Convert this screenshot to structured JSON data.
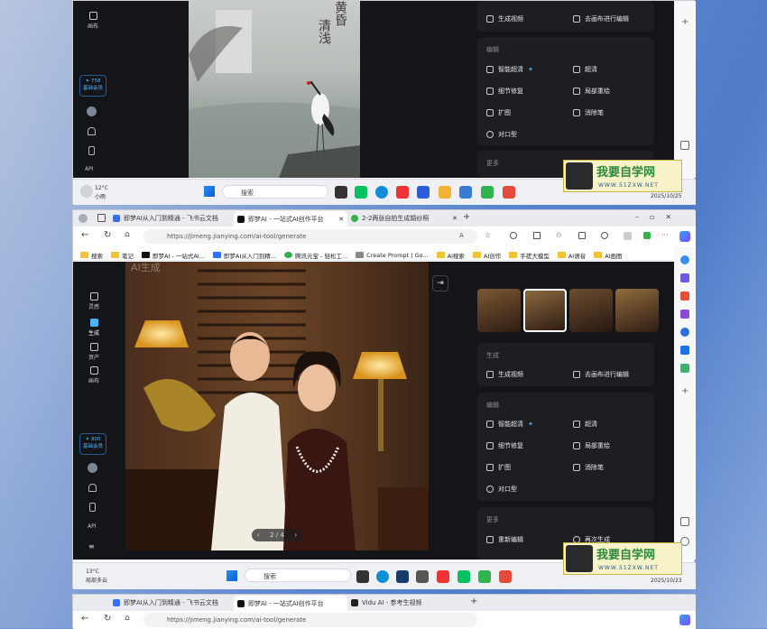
{
  "top_window": {
    "rail": {
      "layout_label": "画布",
      "credits": "✦ 758",
      "member": "基础会员",
      "api": "API"
    },
    "poster_text": [
      "黄昏",
      "清浅"
    ],
    "gen_panel": {
      "make_video": "生成视频",
      "to_canvas": "去画布进行编辑"
    },
    "edit_panel": {
      "title": "编辑",
      "smart_hd": "智能超清",
      "hd": "超清",
      "detail_fix": "细节修复",
      "local_redraw": "局部重绘",
      "expand": "扩图",
      "eraser": "消除笔",
      "lip_sync": "对口型"
    },
    "more_title": "更多"
  },
  "taskbar1": {
    "weather_temp": "12°C",
    "weather_desc": "小雨",
    "search": "搜索",
    "time": "",
    "date": "2025/10/25"
  },
  "browser": {
    "tabs": [
      {
        "label": "即梦AI从入门到精通 - 飞书云文档",
        "active": false
      },
      {
        "label": "即梦AI - 一站式AI创作平台",
        "active": true
      },
      {
        "label": "2-2两张自拍生成婚纱照",
        "active": false
      }
    ],
    "url": "https://jimeng.jianying.com/ai-tool/generate",
    "bookmarks": [
      "搜索",
      "笔记",
      "即梦AI - 一站式AI...",
      "即梦AI从入门到精...",
      "腾讯元宝 - 轻松工...",
      "Create Prompt | Go...",
      "AI搜索",
      "AI创作",
      "手搓大模型",
      "AI语音",
      "AI画图"
    ]
  },
  "app": {
    "rail": [
      {
        "label": "灵感",
        "icon": "home-icon"
      },
      {
        "label": "生成",
        "icon": "generate-icon"
      },
      {
        "label": "资产",
        "icon": "folder-icon"
      },
      {
        "label": "画布",
        "icon": "canvas-icon"
      }
    ],
    "credits": "✦ 900",
    "member": "基础会员",
    "api": "API",
    "pager": "2 / 4",
    "faded_label": "AI生成",
    "gen_panel": {
      "title": "生成",
      "make_video": "生成视频",
      "to_canvas": "去画布进行编辑"
    },
    "edit_panel": {
      "title": "编辑",
      "smart_hd": "智能超清",
      "hd": "超清",
      "detail_fix": "细节修复",
      "local_redraw": "局部重绘",
      "expand": "扩图",
      "eraser": "消除笔",
      "lip_sync": "对口型"
    },
    "more_panel": {
      "title": "更多",
      "re_edit": "重新编辑",
      "regenerate": "再次生成"
    }
  },
  "taskbar2": {
    "weather_temp": "13°C",
    "weather_desc": "局部多云",
    "search": "搜索",
    "date": "2025/10/23"
  },
  "bottom_browser": {
    "tabs": [
      "即梦AI从入门到精通 - 飞书云文档",
      "即梦AI - 一站式AI创作平台",
      "Vidu AI - 参考生视频"
    ],
    "url": "https://jimeng.jianying.com/ai-tool/generate"
  },
  "watermark": {
    "title": "我要自学网",
    "url": "WWW.51ZXW.NET"
  }
}
